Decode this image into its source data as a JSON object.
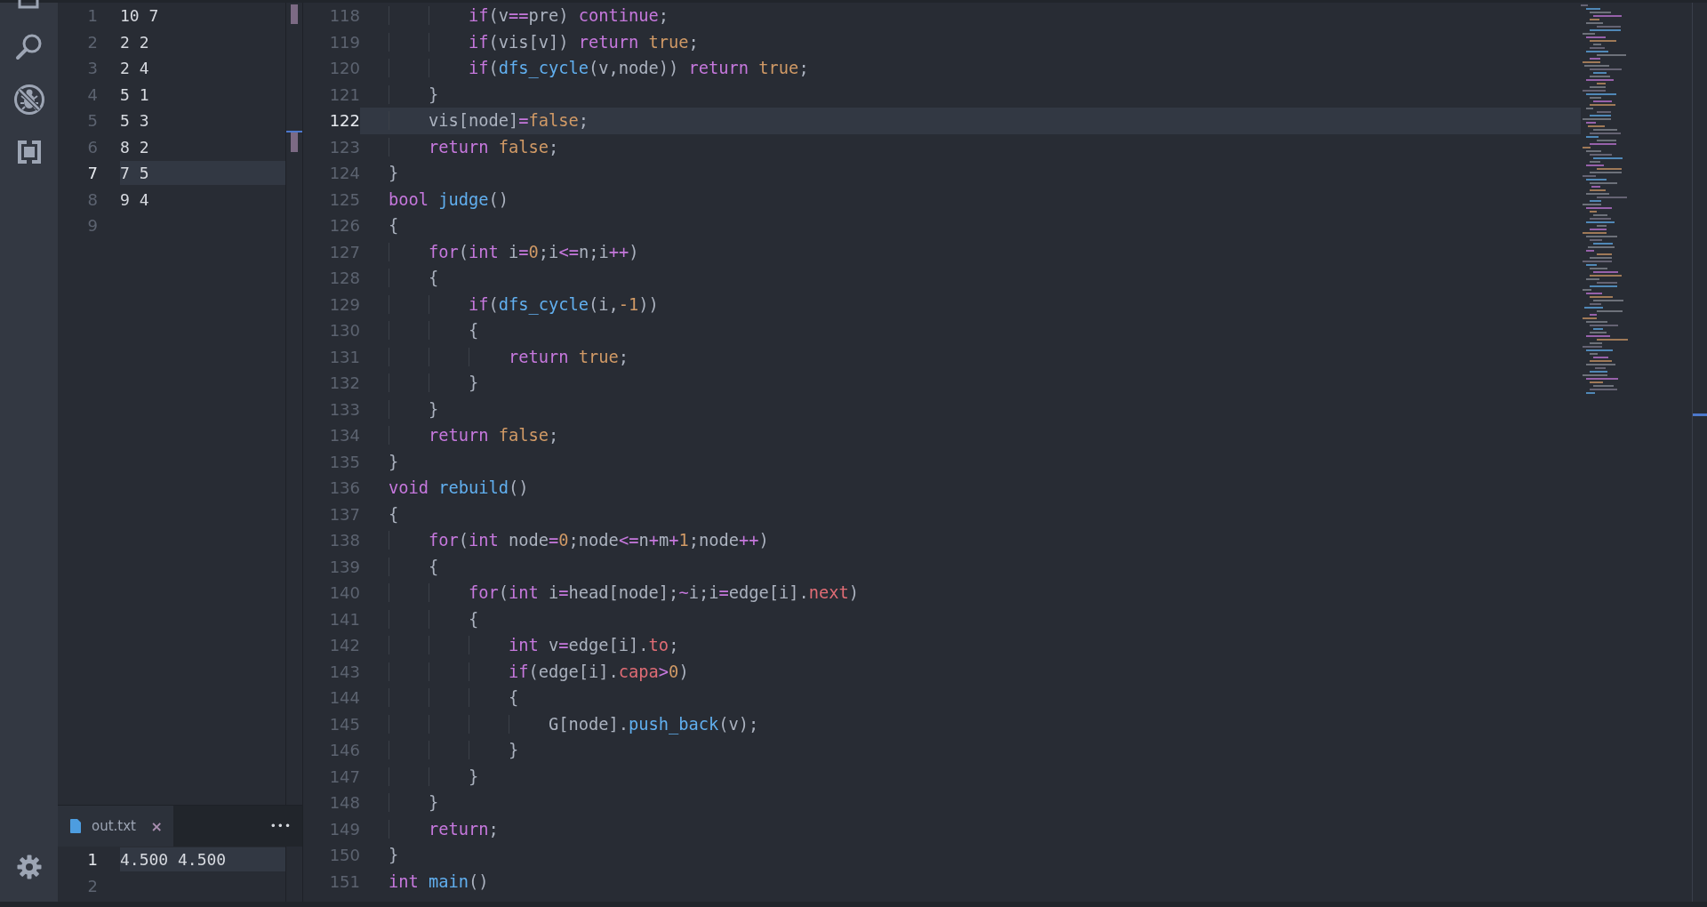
{
  "input_editor": {
    "lines": [
      {
        "number": "1",
        "text": "10 7",
        "active": false
      },
      {
        "number": "2",
        "text": "2 2",
        "active": false
      },
      {
        "number": "3",
        "text": "2 4",
        "active": false
      },
      {
        "number": "4",
        "text": "5 1",
        "active": false
      },
      {
        "number": "5",
        "text": "5 3",
        "active": false
      },
      {
        "number": "6",
        "text": "8 2",
        "active": false
      },
      {
        "number": "7",
        "text": "7 5",
        "active": true
      },
      {
        "number": "8",
        "text": "9 4",
        "active": false
      },
      {
        "number": "9",
        "active": false
      }
    ]
  },
  "output_panel": {
    "tab": {
      "label": "out.txt",
      "close": "×",
      "selected": true
    },
    "more": "•••",
    "lines": [
      {
        "number": "1",
        "text": "4.500 4.500",
        "active": true
      },
      {
        "number": "2",
        "active": false
      }
    ]
  },
  "code_editor": {
    "lines": [
      {
        "number": "118",
        "active": false,
        "tokens": [
          {
            "kind": "keyword",
            "text": "        if"
          },
          {
            "kind": "plain",
            "text": "(v"
          },
          {
            "kind": "operator",
            "text": "=="
          },
          {
            "kind": "plain",
            "text": "pre) "
          },
          {
            "kind": "keyword",
            "text": "continue"
          },
          {
            "kind": "plain",
            "text": ";"
          }
        ]
      },
      {
        "number": "119",
        "active": false,
        "tokens": [
          {
            "kind": "keyword",
            "text": "        if"
          },
          {
            "kind": "plain",
            "text": "(vis[v]) "
          },
          {
            "kind": "keyword",
            "text": "return "
          },
          {
            "kind": "constant",
            "text": "true"
          },
          {
            "kind": "plain",
            "text": ";"
          }
        ]
      },
      {
        "number": "120",
        "active": false,
        "tokens": [
          {
            "kind": "keyword",
            "text": "        if"
          },
          {
            "kind": "plain",
            "text": "("
          },
          {
            "kind": "function",
            "text": "dfs_cycle"
          },
          {
            "kind": "plain",
            "text": "(v,node)) "
          },
          {
            "kind": "keyword",
            "text": "return "
          },
          {
            "kind": "constant",
            "text": "true"
          },
          {
            "kind": "plain",
            "text": ";"
          }
        ]
      },
      {
        "number": "121",
        "active": false,
        "tokens": [
          {
            "kind": "plain",
            "text": "    }"
          }
        ]
      },
      {
        "number": "122",
        "active": true,
        "tokens": [
          {
            "kind": "plain",
            "text": "    vis[node]"
          },
          {
            "kind": "operator",
            "text": "="
          },
          {
            "kind": "constant",
            "text": "false"
          },
          {
            "kind": "plain",
            "text": ";"
          }
        ]
      },
      {
        "number": "123",
        "active": false,
        "tokens": [
          {
            "kind": "keyword",
            "text": "    return "
          },
          {
            "kind": "constant",
            "text": "false"
          },
          {
            "kind": "plain",
            "text": ";"
          }
        ]
      },
      {
        "number": "124",
        "active": false,
        "tokens": [
          {
            "kind": "plain",
            "text": "}"
          }
        ]
      },
      {
        "number": "125",
        "active": false,
        "tokens": [
          {
            "kind": "keyword",
            "text": "bool "
          },
          {
            "kind": "function",
            "text": "judge"
          },
          {
            "kind": "plain",
            "text": "()"
          }
        ]
      },
      {
        "number": "126",
        "active": false,
        "tokens": [
          {
            "kind": "plain",
            "text": "{"
          }
        ]
      },
      {
        "number": "127",
        "active": false,
        "tokens": [
          {
            "kind": "keyword",
            "text": "    for"
          },
          {
            "kind": "plain",
            "text": "("
          },
          {
            "kind": "keyword",
            "text": "int"
          },
          {
            "kind": "plain",
            "text": " i"
          },
          {
            "kind": "operator",
            "text": "="
          },
          {
            "kind": "constant",
            "text": "0"
          },
          {
            "kind": "plain",
            "text": ";i"
          },
          {
            "kind": "operator",
            "text": "<="
          },
          {
            "kind": "plain",
            "text": "n;i"
          },
          {
            "kind": "operator",
            "text": "++"
          },
          {
            "kind": "plain",
            "text": ")"
          }
        ]
      },
      {
        "number": "128",
        "active": false,
        "tokens": [
          {
            "kind": "plain",
            "text": "    {"
          }
        ]
      },
      {
        "number": "129",
        "active": false,
        "tokens": [
          {
            "kind": "keyword",
            "text": "        if"
          },
          {
            "kind": "plain",
            "text": "("
          },
          {
            "kind": "function",
            "text": "dfs_cycle"
          },
          {
            "kind": "plain",
            "text": "(i,"
          },
          {
            "kind": "constant",
            "text": "-1"
          },
          {
            "kind": "plain",
            "text": "))"
          }
        ]
      },
      {
        "number": "130",
        "active": false,
        "tokens": [
          {
            "kind": "plain",
            "text": "        {"
          }
        ]
      },
      {
        "number": "131",
        "active": false,
        "tokens": [
          {
            "kind": "keyword",
            "text": "            return "
          },
          {
            "kind": "constant",
            "text": "true"
          },
          {
            "kind": "plain",
            "text": ";"
          }
        ]
      },
      {
        "number": "132",
        "active": false,
        "tokens": [
          {
            "kind": "plain",
            "text": "        }"
          }
        ]
      },
      {
        "number": "133",
        "active": false,
        "tokens": [
          {
            "kind": "plain",
            "text": "    }"
          }
        ]
      },
      {
        "number": "134",
        "active": false,
        "tokens": [
          {
            "kind": "keyword",
            "text": "    return "
          },
          {
            "kind": "constant",
            "text": "false"
          },
          {
            "kind": "plain",
            "text": ";"
          }
        ]
      },
      {
        "number": "135",
        "active": false,
        "tokens": [
          {
            "kind": "plain",
            "text": "}"
          }
        ]
      },
      {
        "number": "136",
        "active": false,
        "tokens": [
          {
            "kind": "keyword",
            "text": "void "
          },
          {
            "kind": "function",
            "text": "rebuild"
          },
          {
            "kind": "plain",
            "text": "()"
          }
        ]
      },
      {
        "number": "137",
        "active": false,
        "tokens": [
          {
            "kind": "plain",
            "text": "{"
          }
        ]
      },
      {
        "number": "138",
        "active": false,
        "tokens": [
          {
            "kind": "keyword",
            "text": "    for"
          },
          {
            "kind": "plain",
            "text": "("
          },
          {
            "kind": "keyword",
            "text": "int"
          },
          {
            "kind": "plain",
            "text": " node"
          },
          {
            "kind": "operator",
            "text": "="
          },
          {
            "kind": "constant",
            "text": "0"
          },
          {
            "kind": "plain",
            "text": ";node"
          },
          {
            "kind": "operator",
            "text": "<="
          },
          {
            "kind": "plain",
            "text": "n"
          },
          {
            "kind": "operator",
            "text": "+"
          },
          {
            "kind": "plain",
            "text": "m"
          },
          {
            "kind": "operator",
            "text": "+"
          },
          {
            "kind": "constant",
            "text": "1"
          },
          {
            "kind": "plain",
            "text": ";node"
          },
          {
            "kind": "operator",
            "text": "++"
          },
          {
            "kind": "plain",
            "text": ")"
          }
        ]
      },
      {
        "number": "139",
        "active": false,
        "tokens": [
          {
            "kind": "plain",
            "text": "    {"
          }
        ]
      },
      {
        "number": "140",
        "active": false,
        "tokens": [
          {
            "kind": "keyword",
            "text": "        for"
          },
          {
            "kind": "plain",
            "text": "("
          },
          {
            "kind": "keyword",
            "text": "int"
          },
          {
            "kind": "plain",
            "text": " i"
          },
          {
            "kind": "operator",
            "text": "="
          },
          {
            "kind": "plain",
            "text": "head[node];"
          },
          {
            "kind": "operator",
            "text": "~"
          },
          {
            "kind": "plain",
            "text": "i;i"
          },
          {
            "kind": "operator",
            "text": "="
          },
          {
            "kind": "plain",
            "text": "edge[i]."
          },
          {
            "kind": "property",
            "text": "next"
          },
          {
            "kind": "plain",
            "text": ")"
          }
        ]
      },
      {
        "number": "141",
        "active": false,
        "tokens": [
          {
            "kind": "plain",
            "text": "        {"
          }
        ]
      },
      {
        "number": "142",
        "active": false,
        "tokens": [
          {
            "kind": "keyword",
            "text": "            int"
          },
          {
            "kind": "plain",
            "text": " v"
          },
          {
            "kind": "operator",
            "text": "="
          },
          {
            "kind": "plain",
            "text": "edge[i]."
          },
          {
            "kind": "property",
            "text": "to"
          },
          {
            "kind": "plain",
            "text": ";"
          }
        ]
      },
      {
        "number": "143",
        "active": false,
        "tokens": [
          {
            "kind": "keyword",
            "text": "            if"
          },
          {
            "kind": "plain",
            "text": "(edge[i]."
          },
          {
            "kind": "property",
            "text": "capa"
          },
          {
            "kind": "operator",
            "text": ">"
          },
          {
            "kind": "constant",
            "text": "0"
          },
          {
            "kind": "plain",
            "text": ")"
          }
        ]
      },
      {
        "number": "144",
        "active": false,
        "tokens": [
          {
            "kind": "plain",
            "text": "            {"
          }
        ]
      },
      {
        "number": "145",
        "active": false,
        "tokens": [
          {
            "kind": "plain",
            "text": "                G[node]."
          },
          {
            "kind": "function",
            "text": "push_back"
          },
          {
            "kind": "plain",
            "text": "(v);"
          }
        ]
      },
      {
        "number": "146",
        "active": false,
        "tokens": [
          {
            "kind": "plain",
            "text": "            }"
          }
        ]
      },
      {
        "number": "147",
        "active": false,
        "tokens": [
          {
            "kind": "plain",
            "text": "        }"
          }
        ]
      },
      {
        "number": "148",
        "active": false,
        "tokens": [
          {
            "kind": "plain",
            "text": "    }"
          }
        ]
      },
      {
        "number": "149",
        "active": false,
        "tokens": [
          {
            "kind": "keyword",
            "text": "    return"
          },
          {
            "kind": "plain",
            "text": ";"
          }
        ]
      },
      {
        "number": "150",
        "active": false,
        "tokens": [
          {
            "kind": "plain",
            "text": "}"
          }
        ]
      },
      {
        "number": "151",
        "active": false,
        "tokens": [
          {
            "kind": "keyword",
            "text": "int "
          },
          {
            "kind": "function",
            "text": "main"
          },
          {
            "kind": "plain",
            "text": "()"
          }
        ]
      }
    ]
  }
}
